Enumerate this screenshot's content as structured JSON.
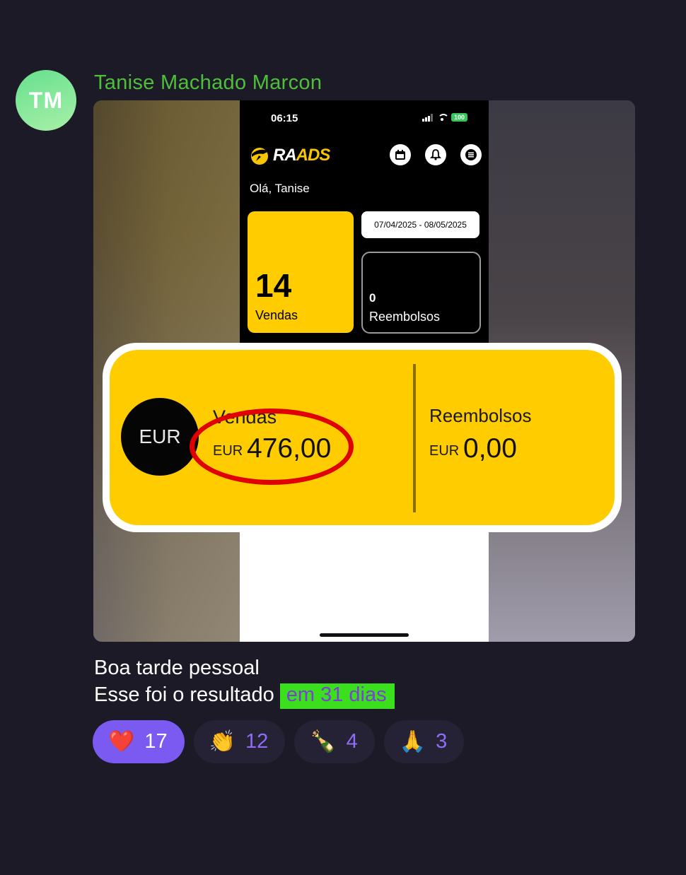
{
  "message": {
    "avatar_initials": "TM",
    "sender_name": "Tanise Machado Marcon",
    "caption_line1": "Boa tarde pessoal",
    "caption_line2": "Esse foi o resultado",
    "caption_highlight": "em 31 dias"
  },
  "screenshot": {
    "status_time": "06:15",
    "battery": "100",
    "app_logo": "RAADS",
    "greeting": "Olá, Tanise",
    "sales_count": "14",
    "sales_label": "Vendas",
    "date_range": "07/04/2025 - 08/05/2025",
    "refunds_count": "0",
    "refunds_label": "Reembolsos",
    "header_icons": [
      "calendar-icon",
      "bell-icon",
      "menu-icon"
    ]
  },
  "zoom_card": {
    "currency_badge": "EUR",
    "sales_label": "Vendas",
    "sales_currency": "EUR",
    "sales_value": "476,00",
    "refunds_label": "Reembolsos",
    "refunds_currency": "EUR",
    "refunds_value": "0,00"
  },
  "reactions": [
    {
      "emoji": "❤️",
      "count": "17",
      "active": true
    },
    {
      "emoji": "👏",
      "count": "12",
      "active": false
    },
    {
      "emoji": "🍾",
      "count": "4",
      "active": false
    },
    {
      "emoji": "🙏",
      "count": "3",
      "active": false
    }
  ],
  "colors": {
    "background": "#1d1a28",
    "sender_name": "#4fbf3a",
    "accent_yellow": "#ffcc00",
    "reaction_active": "#7a5af0",
    "highlight_bg": "#3be01c"
  }
}
